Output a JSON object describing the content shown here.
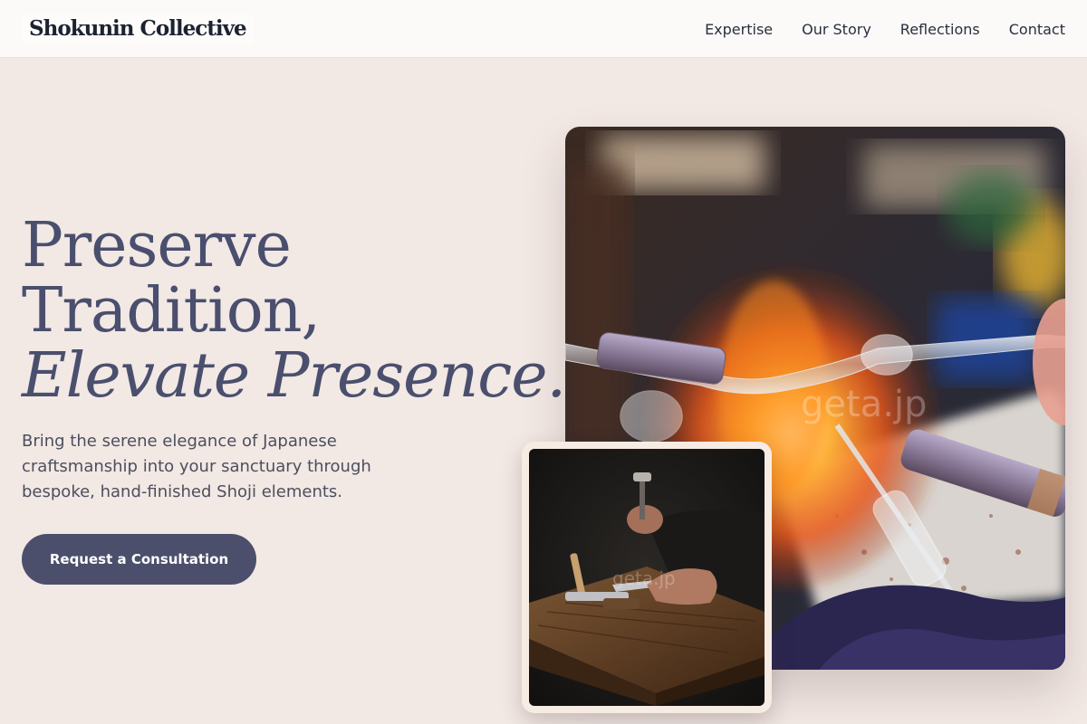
{
  "header": {
    "brand": "Shokunin Collective",
    "nav": [
      "Expertise",
      "Our Story",
      "Reflections",
      "Contact"
    ]
  },
  "hero": {
    "title_line1": "Preserve",
    "title_line2": "Tradition,",
    "title_line3": "Elevate Presence.",
    "subtitle": "Bring the serene elegance of Japanese craftsmanship into your sanctuary through bespoke, hand-finished Shoji elements.",
    "cta_label": "Request a Consultation"
  },
  "images": {
    "main_watermark": "geta.jp",
    "small_watermark": "geta.jp"
  },
  "colors": {
    "background": "#f2e8e4",
    "heading": "#4a4f6e",
    "cta": "#4b4f6b"
  }
}
